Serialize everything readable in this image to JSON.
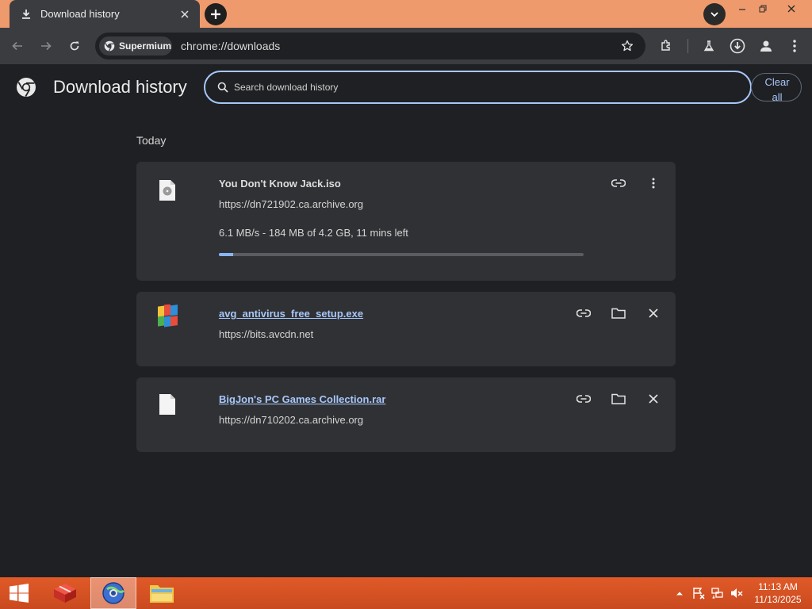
{
  "browser": {
    "tab_title": "Download history",
    "site_chip_label": "Supermium",
    "url": "chrome://downloads"
  },
  "page": {
    "title": "Download history",
    "search_placeholder": "Search download history",
    "clear_all_line1": "Clear",
    "clear_all_line2": "all",
    "section_heading": "Today"
  },
  "downloads": [
    {
      "file_name": "You Don't Know Jack.iso",
      "url": "https://dn721902.ca.archive.org",
      "status": "6.1 MB/s - 184 MB of 4.2 GB, 11 mins left",
      "progress_fraction": 0.04,
      "in_progress": true
    },
    {
      "file_name": "avg_antivirus_free_setup.exe",
      "url": "https://bits.avcdn.net",
      "in_progress": false
    },
    {
      "file_name": "BigJon's PC Games Collection.rar",
      "url": "https://dn710202.ca.archive.org",
      "in_progress": false
    }
  ],
  "taskbar": {
    "time": "11:13 AM",
    "date": "11/13/2025"
  },
  "colors": {
    "titlebar": "#ee9a6c",
    "toolbar": "#3b3c40",
    "page_bg": "#1f2023",
    "card_bg": "#303134",
    "accent_link": "#a8c7fa",
    "taskbar": "#d4511f"
  }
}
